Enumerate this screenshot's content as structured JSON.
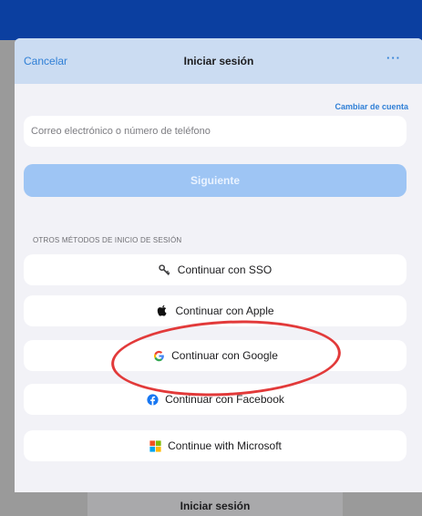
{
  "nav": {
    "cancel_label": "Cancelar",
    "title": "Iniciar sesión",
    "more_label": "···"
  },
  "account": {
    "switch_label": "Cambiar de cuenta"
  },
  "email": {
    "placeholder": "Correo electrónico o número de teléfono",
    "value": ""
  },
  "next_button": {
    "label": "Siguiente"
  },
  "other_methods": {
    "heading": "OTROS MÉTODOS DE INICIO DE SESIÓN",
    "items": [
      {
        "label": "Continuar con SSO",
        "icon": "key-icon"
      },
      {
        "label": "Continuar con Apple",
        "icon": "apple-icon"
      },
      {
        "label": "Continuar con Google",
        "icon": "google-icon"
      },
      {
        "label": "Continuar con Facebook",
        "icon": "facebook-icon"
      },
      {
        "label": "Continue with Microsoft",
        "icon": "microsoft-icon"
      }
    ]
  },
  "bottom": {
    "signin_label": "Iniciar sesión"
  },
  "colors": {
    "accent": "#2f7fd6",
    "nav_bg": "#cbdcf2",
    "primary_disabled": "#9ec5f4",
    "highlight": "#e23a3a",
    "facebook": "#1877f2",
    "google_blue": "#4285f4"
  }
}
